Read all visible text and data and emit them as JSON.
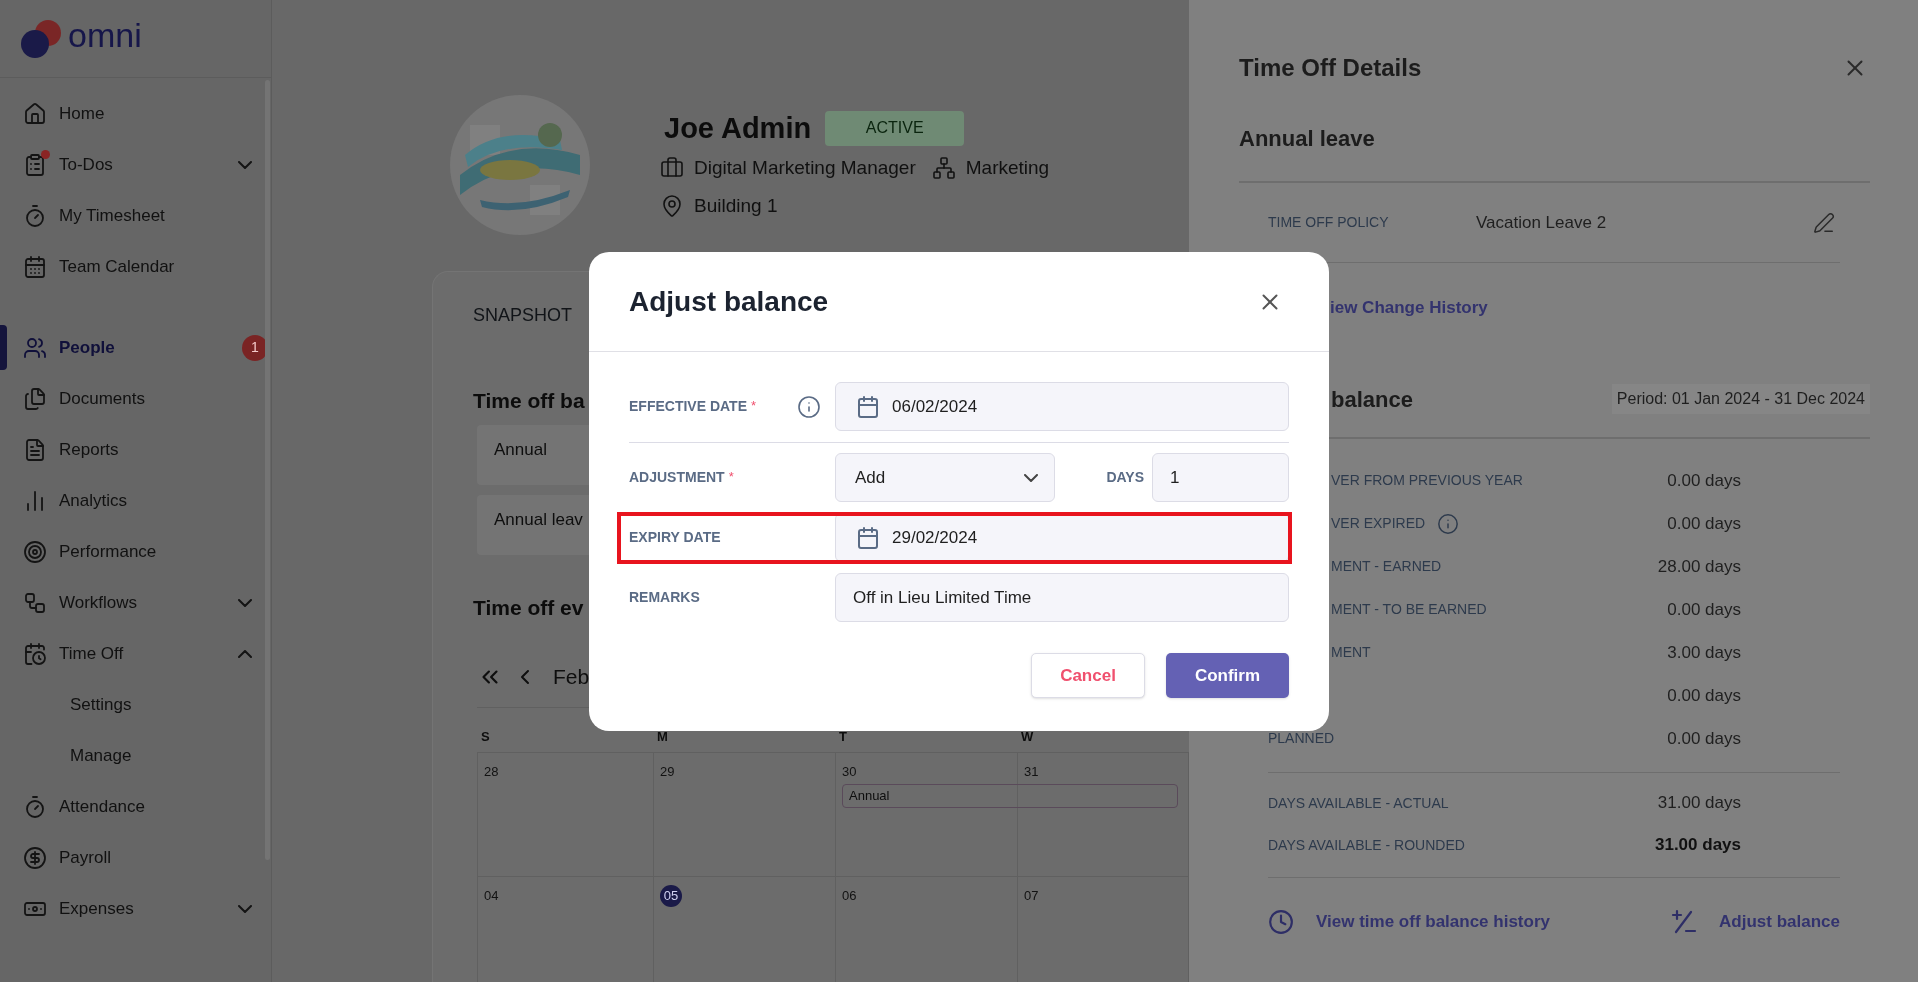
{
  "app": {
    "logo": "omni"
  },
  "sidebar": {
    "sections": [
      {
        "items": [
          {
            "label": "Home",
            "selected": false,
            "notification": false
          },
          {
            "label": "To-Dos",
            "selected": false,
            "notification": true,
            "expanded": false
          },
          {
            "label": "My Timesheet",
            "selected": false,
            "notification": false
          },
          {
            "label": "Team Calendar",
            "selected": false,
            "notification": false
          }
        ]
      },
      {
        "items": [
          {
            "label": "People",
            "selected": true,
            "notification": false,
            "badge": "1"
          },
          {
            "label": "Documents",
            "selected": false,
            "notification": false
          },
          {
            "label": "Reports",
            "selected": false,
            "notification": false
          },
          {
            "label": "Analytics",
            "selected": false,
            "notification": false
          },
          {
            "label": "Performance",
            "selected": false,
            "notification": false
          },
          {
            "label": "Workflows",
            "selected": false,
            "notification": false,
            "expanded": false
          },
          {
            "label": "Time Off",
            "selected": false,
            "notification": false,
            "expanded": true,
            "children": [
              {
                "label": "Settings",
                "selected": false
              },
              {
                "label": "Manage",
                "selected": false
              }
            ]
          },
          {
            "label": "Attendance",
            "selected": false,
            "notification": false
          },
          {
            "label": "Payroll",
            "selected": false,
            "notification": false
          },
          {
            "label": "Expenses",
            "selected": false,
            "notification": false,
            "expanded": false
          }
        ]
      }
    ]
  },
  "profile": {
    "name": "Joe Admin",
    "status": "ACTIVE",
    "job_title": "Digital Marketing Manager",
    "department": "Marketing",
    "location": "Building 1"
  },
  "card": {
    "tab": "SNAPSHOT",
    "balances_heading": "Time off ba",
    "balance_rows": [
      "Annual",
      "Annual leav"
    ],
    "events_heading": "Time off ev",
    "month": "Feb",
    "weekdays": [
      "S",
      "M",
      "T",
      "W"
    ],
    "weeks": [
      [
        {
          "day": "28",
          "today": false
        },
        {
          "day": "29",
          "today": false
        },
        {
          "day": "30",
          "today": false,
          "event": "Annual"
        },
        {
          "day": "31",
          "today": false
        }
      ],
      [
        {
          "day": "04",
          "today": false
        },
        {
          "day": "05",
          "today": true
        },
        {
          "day": "06",
          "today": false
        },
        {
          "day": "07",
          "today": false
        }
      ]
    ]
  },
  "dialog": {
    "title": "Adjust balance",
    "fields": [
      {
        "kind": "date",
        "label": "EFFECTIVE DATE",
        "required_mark": "*",
        "info": true,
        "value": "06/02/2024",
        "highlighted": false
      },
      {
        "kind": "select",
        "label": "ADJUSTMENT",
        "required_mark": "*",
        "info": false,
        "value": "Add",
        "extra_label": "DAYS",
        "extra_value": "1",
        "highlighted": false
      },
      {
        "kind": "date",
        "label": "EXPIRY DATE",
        "info": false,
        "value": "29/02/2024",
        "highlighted": true
      },
      {
        "kind": "text",
        "label": "REMARKS",
        "info": false,
        "value": "Off in Lieu Limited Time",
        "highlighted": false
      }
    ],
    "cancel": "Cancel",
    "confirm": "Confirm"
  },
  "details_panel": {
    "title": "Time Off Details",
    "leave_type": "Annual leave",
    "policy_label": "TIME OFF POLICY",
    "policy_value": "Vacation Leave 2",
    "history_link": "iew Change History",
    "balance_heading": "balance",
    "period": "Period: 01 Jan 2024 - 31 Dec 2024",
    "rows": [
      {
        "label": "VER FROM PREVIOUS YEAR",
        "info": false,
        "value": "0.00 days"
      },
      {
        "label": "VER EXPIRED",
        "info": true,
        "value": "0.00 days"
      },
      {
        "label": "MENT - EARNED",
        "info": false,
        "value": "28.00 days"
      },
      {
        "label": "MENT - TO BE EARNED",
        "info": false,
        "value": "0.00 days"
      },
      {
        "label": "MENT",
        "info": false,
        "value": "3.00 days"
      },
      {
        "info": false,
        "value": "0.00 days"
      },
      {
        "label": "PLANNED",
        "info": false,
        "value": "0.00 days"
      }
    ],
    "totals": [
      {
        "label": "DAYS AVAILABLE - ACTUAL",
        "value": "31.00 days",
        "bold": false
      },
      {
        "label": "DAYS AVAILABLE - ROUNDED",
        "value": "31.00 days",
        "bold": true
      }
    ],
    "history_action": "View time off balance history",
    "adjust_action": "Adjust balance"
  }
}
